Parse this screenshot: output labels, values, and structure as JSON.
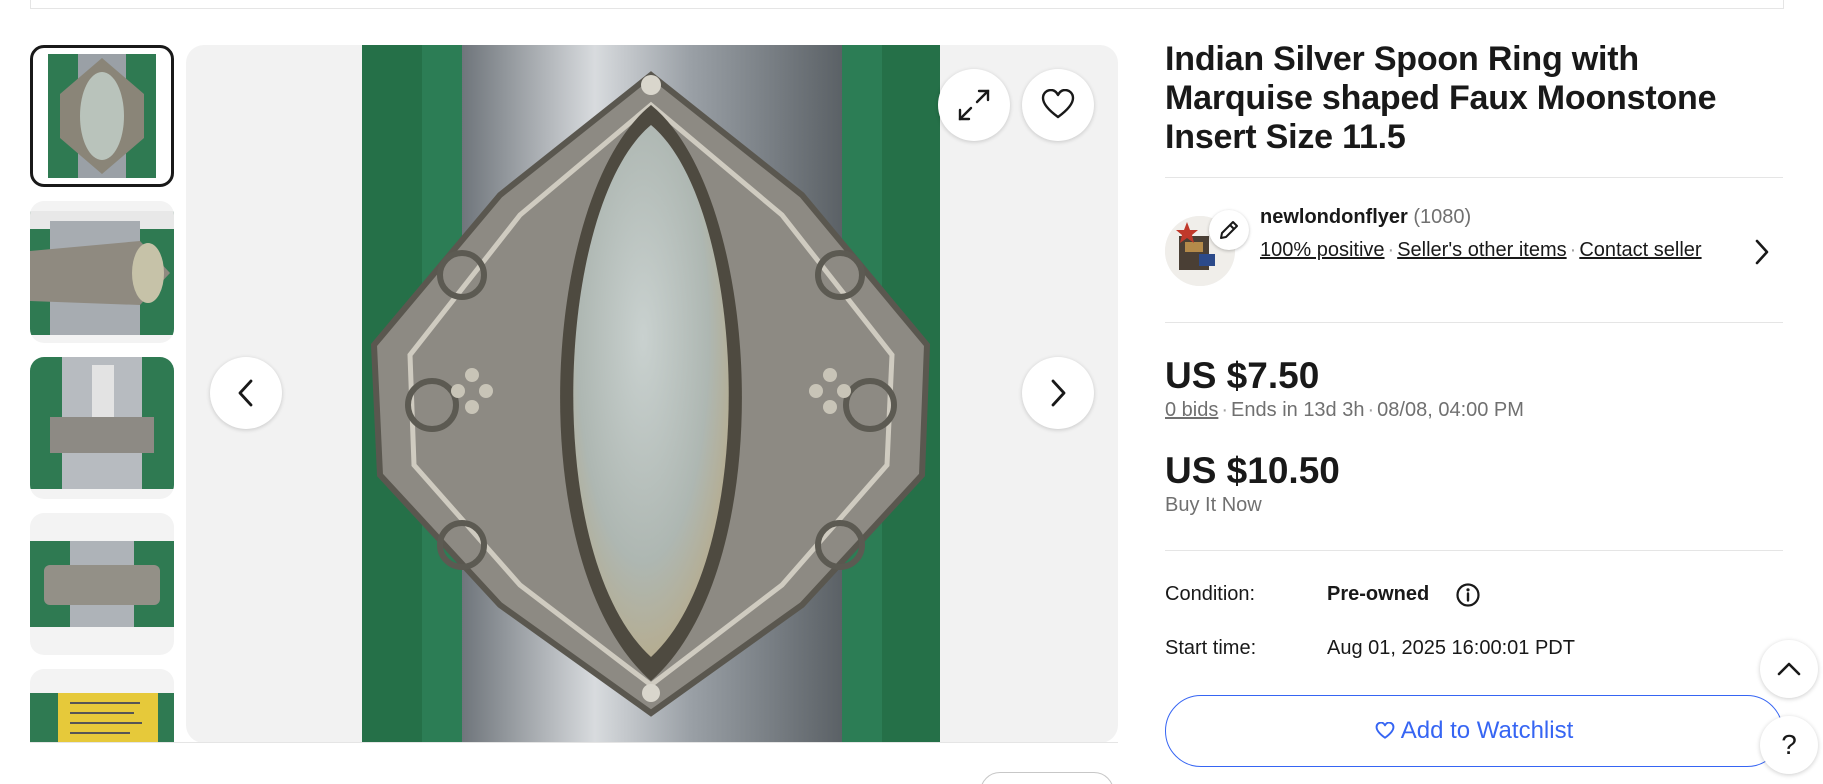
{
  "listing": {
    "title": "Indian Silver Spoon Ring with Marquise shaped Faux Moonstone Insert Size 11.5"
  },
  "gallery": {
    "thumbnail_count_visible": 5,
    "selected_thumbnail": 1,
    "icons": {
      "expand": "expand-icon",
      "watch": "heart-icon",
      "previous": "chevron-left-icon",
      "next": "chevron-right-icon"
    }
  },
  "seller": {
    "name": "newlondonflyer",
    "feedback_count": "(1080)",
    "positive": "100% positive",
    "other_items": "Seller's other items",
    "contact": "Contact seller"
  },
  "pricing": {
    "bid_price": "US $7.50",
    "bids": "0 bids",
    "ends": "Ends in 13d 3h",
    "end_date": "08/08, 04:00 PM",
    "bin_price": "US $10.50",
    "bin_label": "Buy It Now"
  },
  "details": {
    "condition_label": "Condition:",
    "condition_value": "Pre-owned",
    "start_label": "Start time:",
    "start_value": "Aug 01, 2025 16:00:01 PDT"
  },
  "actions": {
    "watchlist_label": "Add to Watchlist"
  },
  "colors": {
    "link_blue": "#3665f3",
    "text_primary": "#191919",
    "text_secondary": "#707070",
    "divider": "#e5e5e5"
  }
}
